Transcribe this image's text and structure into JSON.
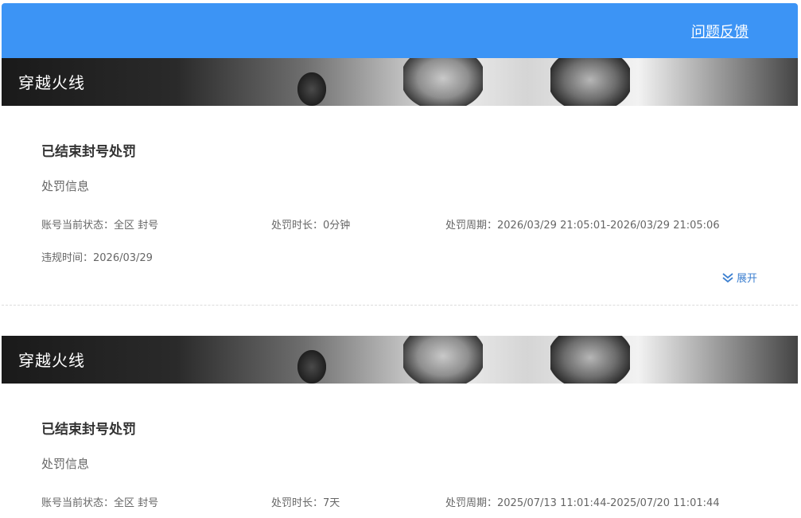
{
  "header": {
    "feedback_label": "问题反馈"
  },
  "records": [
    {
      "game_title": "穿越火线",
      "status_title": "已结束封号处罚",
      "section_label": "处罚信息",
      "account_status_label": "账号当前状态：",
      "account_status_value": "全区 封号",
      "duration_label": "处罚时长：",
      "duration_value": "0分钟",
      "period_label": "处罚周期：",
      "period_value": "2026/03/29 21:05:01-2026/03/29 21:05:06",
      "violation_time_label": "违规时间：",
      "violation_time_value": "2026/03/29",
      "expand_label": "展开"
    },
    {
      "game_title": "穿越火线",
      "status_title": "已结束封号处罚",
      "section_label": "处罚信息",
      "account_status_label": "账号当前状态：",
      "account_status_value": "全区 封号",
      "duration_label": "处罚时长：",
      "duration_value": "7天",
      "period_label": "处罚周期：",
      "period_value": "2025/07/13 11:01:44-2025/07/20 11:01:44"
    }
  ],
  "colors": {
    "accent": "#3c94f5",
    "link": "#3c7fd0"
  },
  "icons": {
    "expand": "chevron-double-down-icon"
  }
}
